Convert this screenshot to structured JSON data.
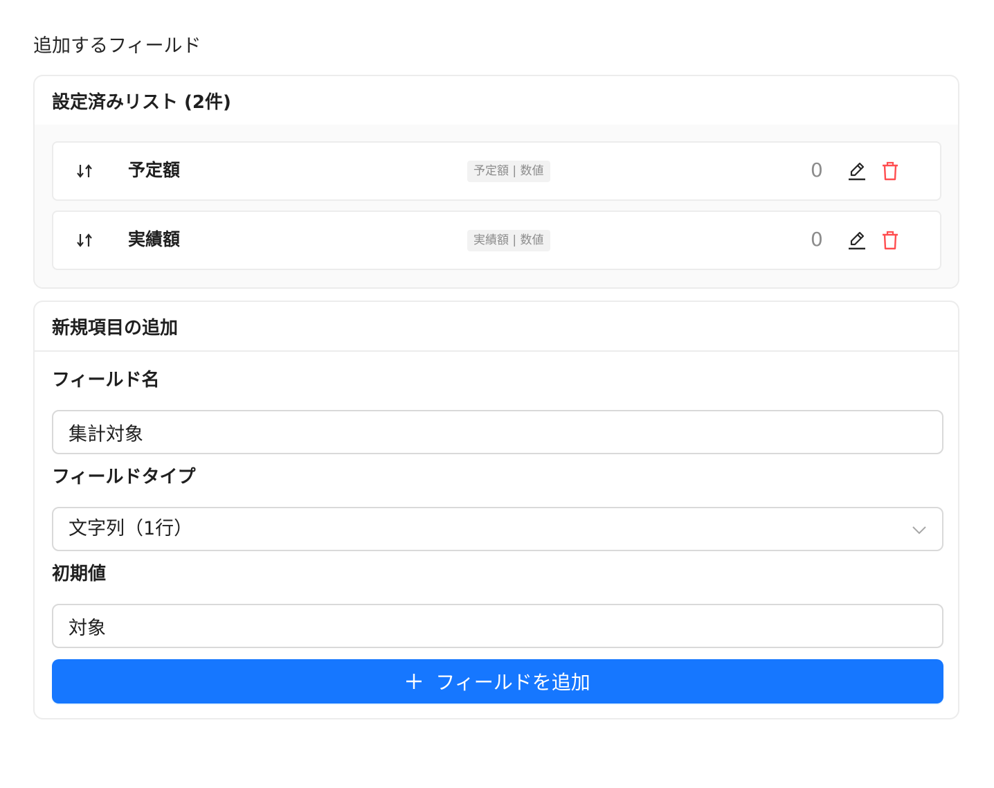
{
  "page": {
    "title": "追加するフィールド"
  },
  "list_card": {
    "title": "設定済みリスト (2件)",
    "items": [
      {
        "name": "予定額",
        "tag": "予定額 | 数値",
        "count": "0"
      },
      {
        "name": "実績額",
        "tag": "実績額 | 数値",
        "count": "0"
      }
    ]
  },
  "new_card": {
    "title": "新規項目の追加",
    "field_name_label": "フィールド名",
    "field_name_value": "集計対象",
    "field_type_label": "フィールドタイプ",
    "field_type_value": "文字列（1行）",
    "initial_value_label": "初期値",
    "initial_value_value": "対象",
    "add_button_label": "フィールドを追加"
  },
  "colors": {
    "primary": "#1677ff",
    "danger": "#ff4d4f",
    "muted": "#8c8c8c",
    "border": "#ececec"
  },
  "icons": {
    "drag": "sort-arrows-icon",
    "edit": "pencil-icon",
    "delete": "trash-icon",
    "select": "chevron-down-icon",
    "add": "plus-icon"
  }
}
